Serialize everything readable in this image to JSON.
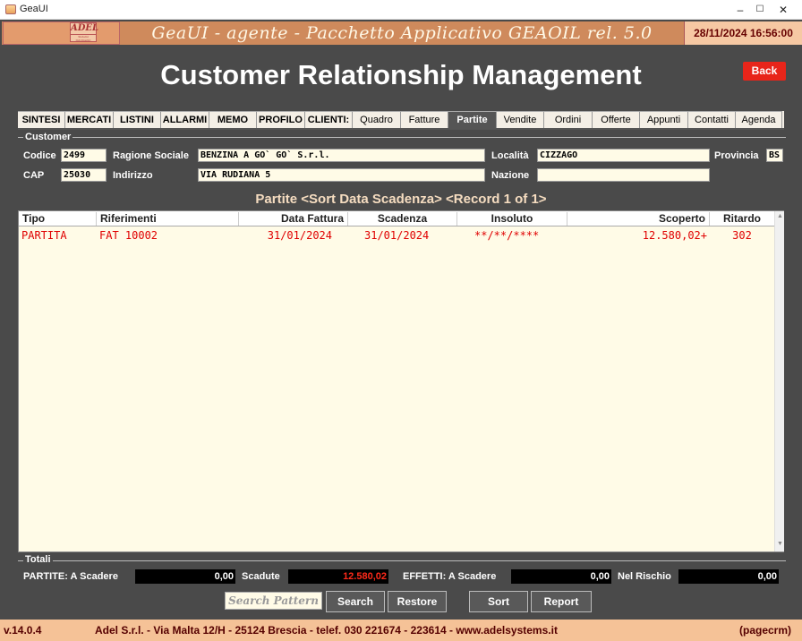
{
  "window": {
    "title": "GeaUI",
    "minimize": "–",
    "maximize": "☐",
    "close": "✕"
  },
  "header": {
    "logo_text": "ADEL",
    "logo_sub": "Sistemi Informativi Personalizzati",
    "app_title": "GeaUI - agente - Pacchetto Applicativo GEAOIL rel. 5.0",
    "datetime": "28/11/2024 16:56:00"
  },
  "page": {
    "title": "Customer Relationship Management",
    "back_label": "Back"
  },
  "tabs": [
    {
      "label": "SINTESI"
    },
    {
      "label": "MERCATI"
    },
    {
      "label": "LISTINI"
    },
    {
      "label": "ALLARMI"
    },
    {
      "label": "MEMO"
    },
    {
      "label": "PROFILO"
    },
    {
      "label": "CLIENTI:"
    },
    {
      "label": "Quadro"
    },
    {
      "label": "Fatture"
    },
    {
      "label": "Partite"
    },
    {
      "label": "Vendite"
    },
    {
      "label": "Ordini"
    },
    {
      "label": "Offerte"
    },
    {
      "label": "Appunti"
    },
    {
      "label": "Contatti"
    },
    {
      "label": "Agenda"
    }
  ],
  "active_tab": "Partite",
  "customer": {
    "section_label": "Customer",
    "codice_label": "Codice",
    "codice": "2499",
    "ragione_label": "Ragione Sociale",
    "ragione": "BENZINA A GO` GO` S.r.l.",
    "localita_label": "Località",
    "localita": "CIZZAGO",
    "provincia_label": "Provincia",
    "provincia": "BS",
    "cap_label": "CAP",
    "cap": "25030",
    "indirizzo_label": "Indirizzo",
    "indirizzo": "VIA RUDIANA 5",
    "nazione_label": "Nazione",
    "nazione": ""
  },
  "grid": {
    "title": "Partite <Sort Data Scadenza> <Record 1 of  1>",
    "columns": [
      "Tipo",
      "Riferimenti",
      "Data Fattura",
      "Scadenza",
      "Insoluto",
      "Scoperto",
      "Ritardo"
    ],
    "rows": [
      {
        "tipo": "PARTITA",
        "riferimenti": "FAT 10002",
        "data_fattura": "31/01/2024",
        "scadenza": "31/01/2024",
        "insoluto": "**/**/****",
        "scoperto": "12.580,02+",
        "ritardo": "302"
      }
    ]
  },
  "totals": {
    "section_label": "Totali",
    "partite_label": "PARTITE: A Scadere",
    "partite_value": "0,00",
    "scadute_label": "Scadute",
    "scadute_value": "12.580,02",
    "effetti_label": "EFFETTI: A Scadere",
    "effetti_value": "0,00",
    "rischio_label": "Nel Rischio",
    "rischio_value": "0,00"
  },
  "buttons": {
    "search_pattern_placeholder": "Search Pattern",
    "search": "Search",
    "restore": "Restore",
    "sort": "Sort",
    "report": "Report"
  },
  "footer": {
    "version": "v.14.0.4",
    "company": "Adel S.r.l. - Via Malta 12/H - 25124 Brescia - telef. 030 221674 - 223614 - www.adelsystems.it",
    "page_id": "(pagecrm)"
  },
  "colors": {
    "accent": "#e8251a",
    "background": "#4a4a4a",
    "row_text": "#e00000",
    "footer": "#f5c297"
  }
}
